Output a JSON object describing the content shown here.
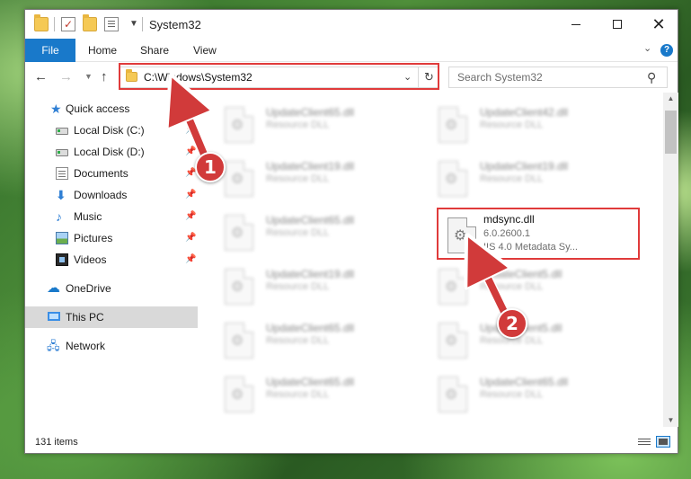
{
  "window": {
    "title": "System32",
    "qa_check": "✓"
  },
  "ribbon": {
    "file_tab": "File",
    "tabs": [
      "Home",
      "Share",
      "View"
    ]
  },
  "nav": {
    "address": "C:\\Windows\\System32",
    "search_placeholder": "Search System32"
  },
  "sidebar": {
    "items": [
      {
        "label": "Quick access",
        "icon": "star-icon",
        "pinned": false
      },
      {
        "label": "Local Disk (C:)",
        "icon": "drive-icon",
        "pinned": true
      },
      {
        "label": "Local Disk (D:)",
        "icon": "drive-icon",
        "pinned": true
      },
      {
        "label": "Documents",
        "icon": "documents-icon",
        "pinned": true
      },
      {
        "label": "Downloads",
        "icon": "download-icon",
        "pinned": true
      },
      {
        "label": "Music",
        "icon": "music-icon",
        "pinned": true
      },
      {
        "label": "Pictures",
        "icon": "pictures-icon",
        "pinned": true
      },
      {
        "label": "Videos",
        "icon": "video-icon",
        "pinned": true
      },
      {
        "label": "OneDrive",
        "icon": "cloud-icon",
        "pinned": false
      },
      {
        "label": "This PC",
        "icon": "pc-icon",
        "pinned": false,
        "selected": true
      },
      {
        "label": "Network",
        "icon": "network-icon",
        "pinned": false
      }
    ]
  },
  "files": [
    {
      "name": "UpdateClient65.dll",
      "type": "Resource DLL"
    },
    {
      "name": "UpdateClient42.dll",
      "type": "Resource DLL"
    },
    {
      "name": "UpdateClient19.dll",
      "type": "Resource DLL"
    },
    {
      "name": "UpdateClient19.dll",
      "type": "Resource DLL"
    },
    {
      "name": "UpdateClient65.dll",
      "type": "Resource DLL"
    },
    {
      "name": "UpdateClient19.dll",
      "type": "Resource DLL"
    },
    {
      "name": "UpdateClient5.dll",
      "type": "Resource DLL"
    },
    {
      "name": "UpdateClient65.dll",
      "type": "Resource DLL"
    },
    {
      "name": "UpdateClient5.dll",
      "type": "Resource DLL"
    },
    {
      "name": "UpdateClient65.dll",
      "type": "Resource DLL"
    },
    {
      "name": "UpdateClient65.dll",
      "type": "Resource DLL"
    }
  ],
  "focused_file": {
    "name": "mdsync.dll",
    "version": "6.0.2600.1",
    "description": "IIS 4.0 Metadata Sy..."
  },
  "status": {
    "item_count": "131 items"
  },
  "annotations": {
    "badge_1": "1",
    "badge_2": "2",
    "color": "#d13a3a"
  },
  "colors": {
    "accent": "#1979ca",
    "highlight": "#e03b3b"
  }
}
